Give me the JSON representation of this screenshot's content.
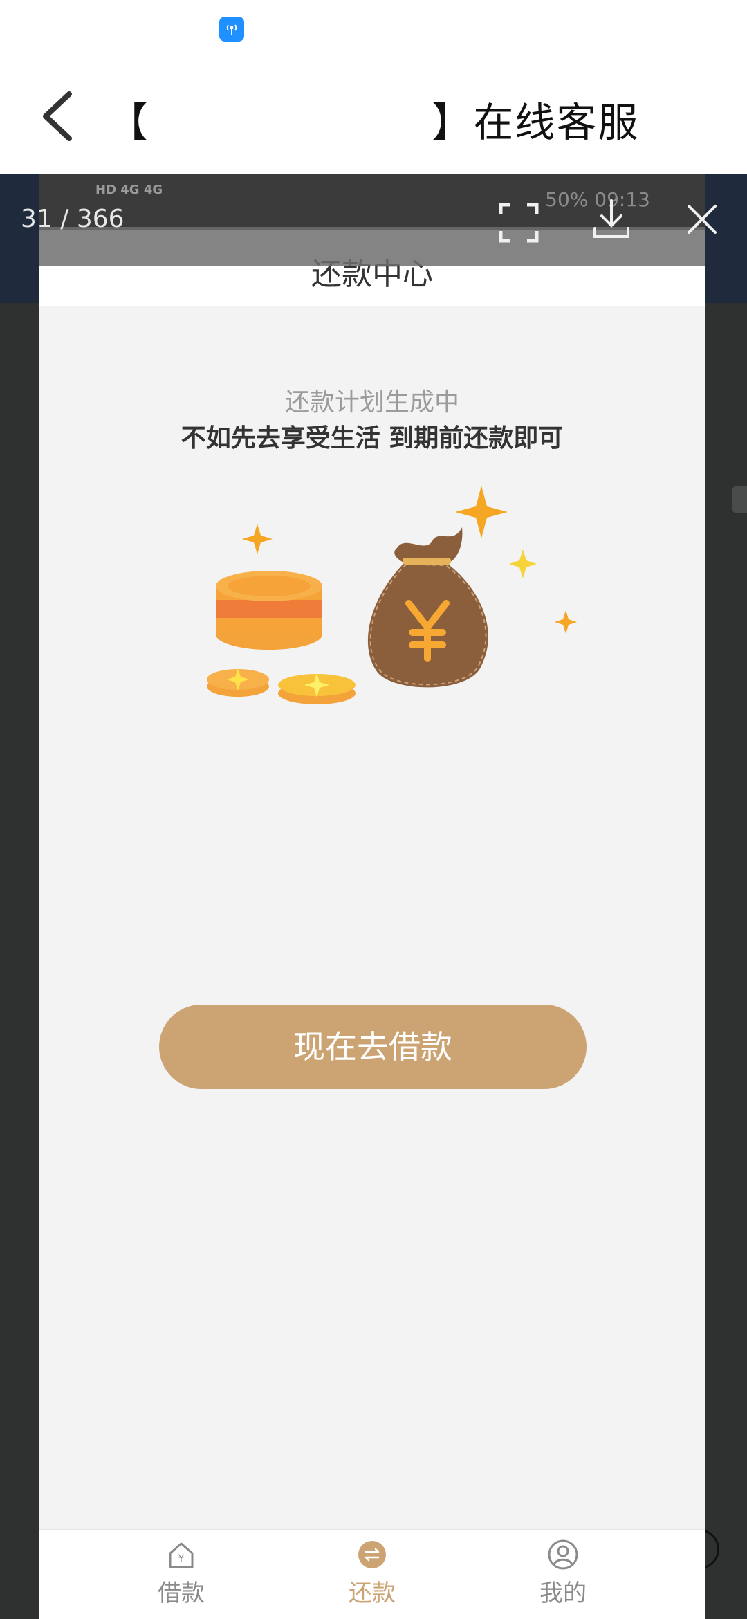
{
  "chat": {
    "title": "【                    】在线客服"
  },
  "viewer": {
    "counter": "31 / 366"
  },
  "screenshot": {
    "status": {
      "left": "HD 4G 4G",
      "right": "50%  09:13"
    },
    "header_title": "还款中心",
    "plan_status": "还款计划生成中",
    "plan_message": "不如先去享受生活 到期前还款即可",
    "borrow_button": "现在去借款",
    "tabs": [
      {
        "label": "借款",
        "icon": "home-yen-icon"
      },
      {
        "label": "还款",
        "icon": "repay-icon"
      },
      {
        "label": "我的",
        "icon": "user-icon"
      }
    ],
    "colors": {
      "accent": "#cca474",
      "coin": "#f7a833",
      "bag": "#8b5e3c"
    }
  }
}
